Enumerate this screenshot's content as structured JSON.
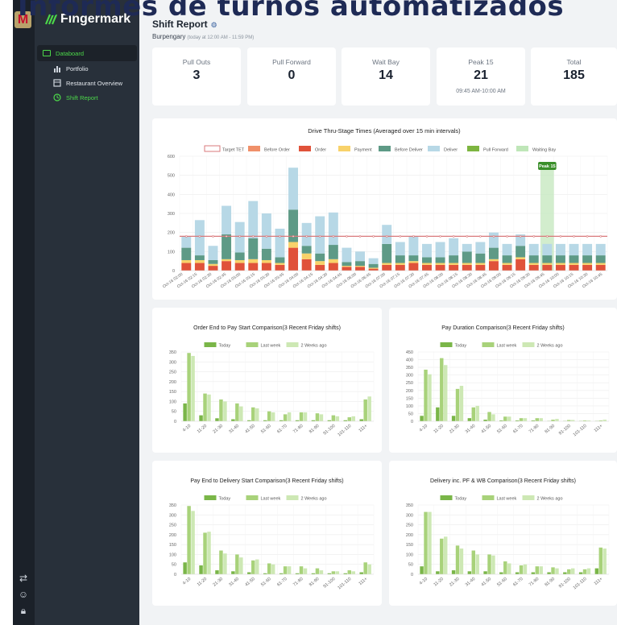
{
  "overlay_title": "Informes de turnos automatizados",
  "brand": "Fingermark",
  "rail_logo": "M",
  "nav": [
    {
      "label": "Databoard"
    },
    {
      "label": "Portfolio"
    },
    {
      "label": "Restaurant Overview"
    },
    {
      "label": "Shift Report"
    }
  ],
  "header": {
    "title": "Shift Report",
    "store": "Burpengary",
    "range": "(today at 12:00 AM - 11:59 PM)"
  },
  "kpis": [
    {
      "label": "Pull Outs",
      "value": "3",
      "sub": ""
    },
    {
      "label": "Pull Forward",
      "value": "0",
      "sub": ""
    },
    {
      "label": "Wait Bay",
      "value": "14",
      "sub": ""
    },
    {
      "label": "Peak 15",
      "value": "21",
      "sub": "09:45 AM-10:00 AM"
    },
    {
      "label": "Total",
      "value": "185",
      "sub": ""
    }
  ],
  "colors": {
    "Before Order": "#f0906a",
    "Order": "#e0523a",
    "Payment": "#f8d26a",
    "Before Deliver": "#5e9a86",
    "Deliver": "#b7d8e6",
    "Pull Forward": "#7db540",
    "Waiting Bay": "#bfe6b8",
    "Target": "#d9797b",
    "Today": "#7ab648",
    "Last week": "#a8d27a",
    "2 Weeks ago": "#cde8b4"
  },
  "chart_data": [
    {
      "type": "bar",
      "stacked": true,
      "title": "Drive Thru-Stage Times (Averaged over 15 min intervals)",
      "legend": [
        "Target TET",
        "Before Order",
        "Order",
        "Payment",
        "Before Deliver",
        "Deliver",
        "Pull Forward",
        "Waiting Bay"
      ],
      "ylim": [
        0,
        600
      ],
      "yticks": [
        0,
        100,
        200,
        300,
        400,
        500,
        600
      ],
      "target": 180,
      "peak_label": "Peak 15",
      "peak_index": 27,
      "categories": [
        "Oct-16 02:00",
        "Oct-16 02:15",
        "Oct-16 02:30",
        "Oct-16 02:45",
        "Oct-16 03:00",
        "Oct-16 03:15",
        "Oct-16 03:30",
        "Oct-16 03:45",
        "Oct-16 04:00",
        "Oct-16 04:15",
        "Oct-16 04:30",
        "Oct-16 04:45",
        "Oct-16 06:00",
        "Oct-16 06:15",
        "Oct-16 06:30",
        "Oct-16 06:45",
        "Oct-16 07:00",
        "Oct-16 07:15",
        "Oct-16 07:30",
        "Oct-16 07:45",
        "Oct-16 08:00",
        "Oct-16 08:15",
        "Oct-16 08:30",
        "Oct-16 08:45",
        "Oct-16 09:00",
        "Oct-16 09:15",
        "Oct-16 09:30",
        "Oct-16 09:45",
        "Oct-16 10:00",
        "Oct-16 10:15",
        "Oct-16 10:30",
        "Oct-16 10:45"
      ],
      "xticks": [
        "Oct-16 02:00",
        "Oct-16 02:15",
        "Oct-16 02:30",
        "Oct-16 02:45",
        "Oct-16 03:00",
        "Oct-16 03:15",
        "Oct-16 03:30",
        "Oct-16 03:45",
        "Oct-16 04:00",
        "Oct-16 04:15",
        "Oct-16 04:30",
        "Oct-16 04:45",
        "Oct-16 06:00",
        "Oct-16 06:45",
        "Oct-16 07:00",
        "Oct-16 07:15",
        "Oct-16 07:30",
        "Oct-16 07:45",
        "Oct-16 08:00",
        "Oct-16 08:15",
        "Oct-16 08:30",
        "Oct-16 08:45",
        "Oct-16 09:00",
        "Oct-16 09:15",
        "Oct-16 09:30",
        "Oct-16 09:45",
        "Oct-16 10:00",
        "Oct-16 10:15",
        "Oct-16 10:30",
        "Oct-16 10:45"
      ],
      "series": [
        {
          "name": "Order",
          "values": [
            40,
            40,
            25,
            50,
            40,
            40,
            40,
            30,
            120,
            60,
            30,
            40,
            20,
            20,
            10,
            30,
            30,
            40,
            30,
            30,
            30,
            30,
            30,
            50,
            30,
            60,
            30,
            30,
            30,
            30,
            30,
            30
          ]
        },
        {
          "name": "Payment",
          "values": [
            15,
            15,
            10,
            10,
            15,
            20,
            15,
            10,
            30,
            30,
            20,
            20,
            5,
            5,
            5,
            10,
            10,
            10,
            10,
            10,
            10,
            10,
            10,
            10,
            10,
            10,
            10,
            10,
            10,
            10,
            10,
            10
          ]
        },
        {
          "name": "Before Deliver",
          "values": [
            65,
            25,
            20,
            130,
            40,
            110,
            60,
            30,
            170,
            40,
            40,
            75,
            20,
            25,
            20,
            100,
            40,
            30,
            30,
            30,
            40,
            60,
            50,
            60,
            40,
            60,
            40,
            40,
            40,
            40,
            40,
            40
          ]
        },
        {
          "name": "Deliver",
          "values": [
            60,
            185,
            75,
            150,
            160,
            195,
            185,
            150,
            220,
            120,
            195,
            170,
            75,
            50,
            30,
            100,
            70,
            100,
            70,
            80,
            90,
            40,
            60,
            80,
            60,
            60,
            60,
            60,
            60,
            60,
            60,
            60
          ]
        }
      ]
    },
    {
      "type": "bar",
      "title": "Order End to Pay Start Comparison(3 Recent Friday shifts)",
      "legend": [
        "Today",
        "Last week",
        "2 Weeks ago"
      ],
      "ylim": [
        0,
        350
      ],
      "yticks": [
        0,
        50,
        100,
        150,
        200,
        250,
        300,
        350
      ],
      "categories": [
        "4-10",
        "11-20",
        "21-30",
        "31-40",
        "41-50",
        "51-60",
        "61-70",
        "71-80",
        "81-90",
        "91-100",
        "101-110",
        "111+"
      ],
      "series": [
        {
          "name": "Today",
          "values": [
            90,
            30,
            15,
            10,
            5,
            5,
            5,
            5,
            5,
            5,
            5,
            10
          ]
        },
        {
          "name": "Last week",
          "values": [
            345,
            140,
            110,
            90,
            70,
            50,
            35,
            45,
            40,
            30,
            20,
            110
          ]
        },
        {
          "name": "2 Weeks ago",
          "values": [
            330,
            135,
            100,
            75,
            65,
            45,
            45,
            45,
            35,
            25,
            25,
            125
          ]
        }
      ]
    },
    {
      "type": "bar",
      "title": "Pay Duration Comparison(3 Recent Friday shifts)",
      "legend": [
        "Today",
        "Last week",
        "2 Weeks ago"
      ],
      "ylim": [
        0,
        450
      ],
      "yticks": [
        0,
        50,
        100,
        150,
        200,
        250,
        300,
        350,
        400,
        450
      ],
      "categories": [
        "4-10",
        "11-20",
        "21-30",
        "31-40",
        "41-50",
        "51-60",
        "61-70",
        "71-80",
        "81-90",
        "91-100",
        "101-110",
        "111+"
      ],
      "series": [
        {
          "name": "Today",
          "values": [
            35,
            90,
            35,
            20,
            10,
            5,
            5,
            5,
            2,
            2,
            2,
            2
          ]
        },
        {
          "name": "Last week",
          "values": [
            335,
            410,
            210,
            90,
            60,
            30,
            20,
            20,
            10,
            8,
            5,
            5
          ]
        },
        {
          "name": "2 Weeks ago",
          "values": [
            305,
            365,
            230,
            100,
            45,
            30,
            20,
            20,
            15,
            8,
            5,
            10
          ]
        }
      ]
    },
    {
      "type": "bar",
      "title": "Pay End to Delivery Start Comparison(3 Recent Friday shifts)",
      "legend": [
        "Today",
        "Last week",
        "2 Weeks ago"
      ],
      "ylim": [
        0,
        350
      ],
      "yticks": [
        0,
        50,
        100,
        150,
        200,
        250,
        300,
        350
      ],
      "categories": [
        "4-10",
        "11-20",
        "21-30",
        "31-40",
        "41-50",
        "51-60",
        "61-70",
        "71-80",
        "81-90",
        "91-100",
        "101-110",
        "111+"
      ],
      "series": [
        {
          "name": "Today",
          "values": [
            60,
            45,
            20,
            15,
            10,
            5,
            5,
            5,
            5,
            5,
            5,
            10
          ]
        },
        {
          "name": "Last week",
          "values": [
            345,
            210,
            120,
            100,
            70,
            55,
            40,
            40,
            30,
            15,
            20,
            60
          ]
        },
        {
          "name": "2 Weeks ago",
          "values": [
            320,
            215,
            105,
            85,
            75,
            50,
            40,
            30,
            20,
            15,
            15,
            50
          ]
        }
      ]
    },
    {
      "type": "bar",
      "title": "Delivery inc. PF & WB Comparison(3 Recent Friday shifts)",
      "legend": [
        "Today",
        "Last week",
        "2 Weeks ago"
      ],
      "ylim": [
        0,
        350
      ],
      "yticks": [
        0,
        50,
        100,
        150,
        200,
        250,
        300,
        350
      ],
      "categories": [
        "4-10",
        "11-20",
        "21-30",
        "31-40",
        "41-50",
        "51-60",
        "61-70",
        "71-80",
        "81-90",
        "91-100",
        "101-110",
        "111+"
      ],
      "series": [
        {
          "name": "Today",
          "values": [
            40,
            15,
            20,
            15,
            15,
            10,
            10,
            10,
            10,
            10,
            10,
            30
          ]
        },
        {
          "name": "Last week",
          "values": [
            315,
            180,
            145,
            120,
            100,
            65,
            45,
            40,
            35,
            25,
            25,
            135
          ]
        },
        {
          "name": "2 Weeks ago",
          "values": [
            315,
            190,
            130,
            100,
            95,
            55,
            50,
            40,
            30,
            30,
            30,
            130
          ]
        }
      ]
    }
  ]
}
